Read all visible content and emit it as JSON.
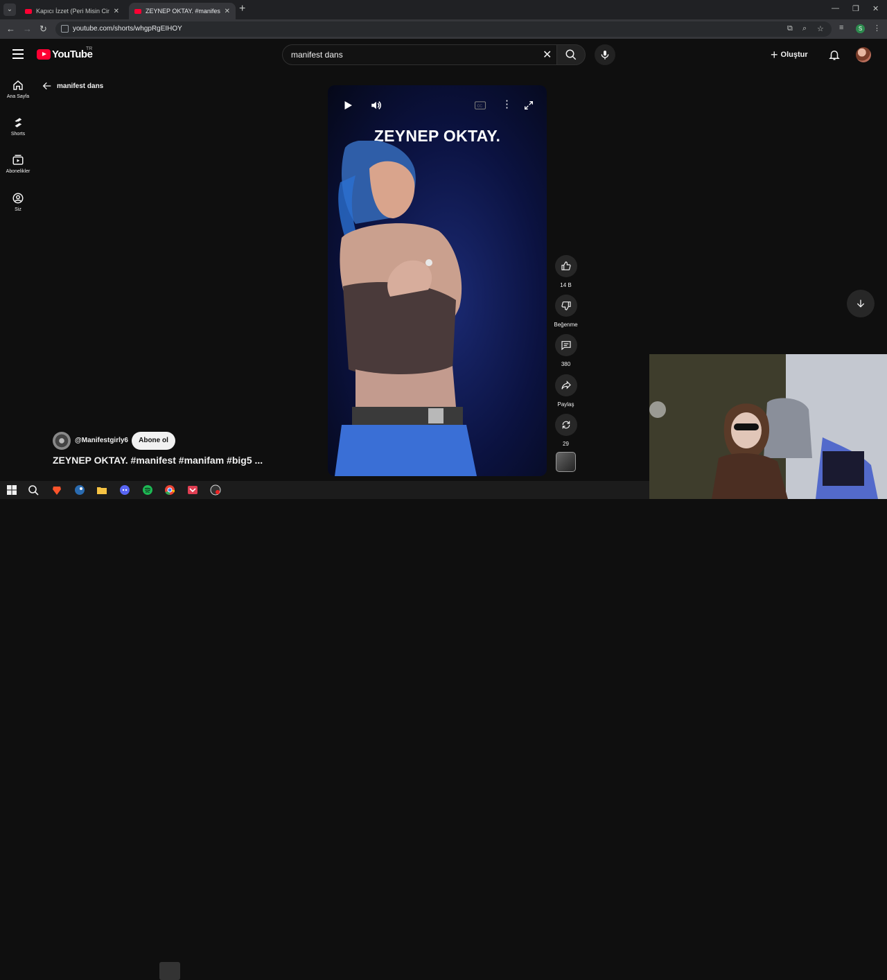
{
  "browser": {
    "tabs": [
      {
        "title": "Kapıcı İzzet (Peri Misin Cin Misin)",
        "active": false
      },
      {
        "title": "ZEYNEP OKTAY. #manifest #manifam",
        "active": true
      }
    ],
    "url": "youtube.com/shorts/whgpRgEIHOY",
    "profile_letter": "S"
  },
  "masthead": {
    "logo_text": "YouTube",
    "country_code": "TR",
    "search_value": "manifest dans",
    "create_label": "Oluştur"
  },
  "guide": [
    {
      "label": "Ana Sayfa",
      "icon": "home-icon"
    },
    {
      "label": "Shorts",
      "icon": "shorts-icon"
    },
    {
      "label": "Abonelikler",
      "icon": "subscriptions-icon"
    },
    {
      "label": "Siz",
      "icon": "you-icon"
    }
  ],
  "back": {
    "label": "manifest dans"
  },
  "video": {
    "overlay_title": "ZEYNEP OKTAY.",
    "channel": "@Manifestgirly6",
    "subscribe_label": "Abone ol",
    "title": "ZEYNEP OKTAY. #manifest #manifam #big5 ..."
  },
  "actions": {
    "like_count": "14 B",
    "dislike_label": "Beğenme",
    "comment_count": "380",
    "share_label": "Paylaş",
    "remix_count": "29"
  },
  "colors": {
    "background": "#0f0f0f",
    "brand_red": "#ff0033",
    "chip": "#272727"
  }
}
